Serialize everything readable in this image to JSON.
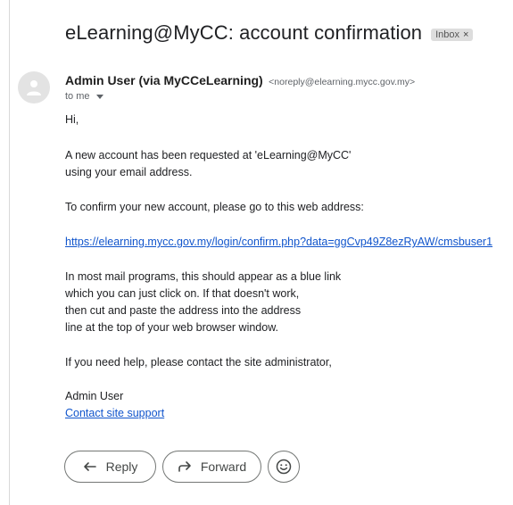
{
  "email": {
    "subject": "eLearning@MyCC: account confirmation",
    "label_chip": "Inbox",
    "label_close": "×",
    "sender_name": "Admin User (via MyCCeLearning)",
    "sender_email": "<noreply@elearning.mycc.gov.my>",
    "recipient": "to me",
    "body": {
      "greeting": "Hi,",
      "para1_line1": "A new account has been requested at 'eLearning@MyCC'",
      "para1_line2": "using your email address.",
      "para2": "To confirm your new account, please go to this web address:",
      "confirm_link": "https://elearning.mycc.gov.my/login/confirm.php?data=ggCvp49Z8ezRyAW/cmsbuser1",
      "para3_line1": "In most mail programs, this should appear as a blue link",
      "para3_line2": "which you can just click on. If that doesn't work,",
      "para3_line3": "then cut and paste the address into the address",
      "para3_line4": "line at the top of your web browser window.",
      "para4": "If you need help, please contact the site administrator,",
      "signature": "Admin User",
      "support_link": "Contact site support"
    }
  },
  "actions": {
    "reply_label": "Reply",
    "forward_label": "Forward",
    "reply_icon": "reply-arrow-icon",
    "forward_icon": "forward-arrow-icon",
    "emoji_icon": "smiley-icon"
  },
  "avatar_icon": "person-icon"
}
